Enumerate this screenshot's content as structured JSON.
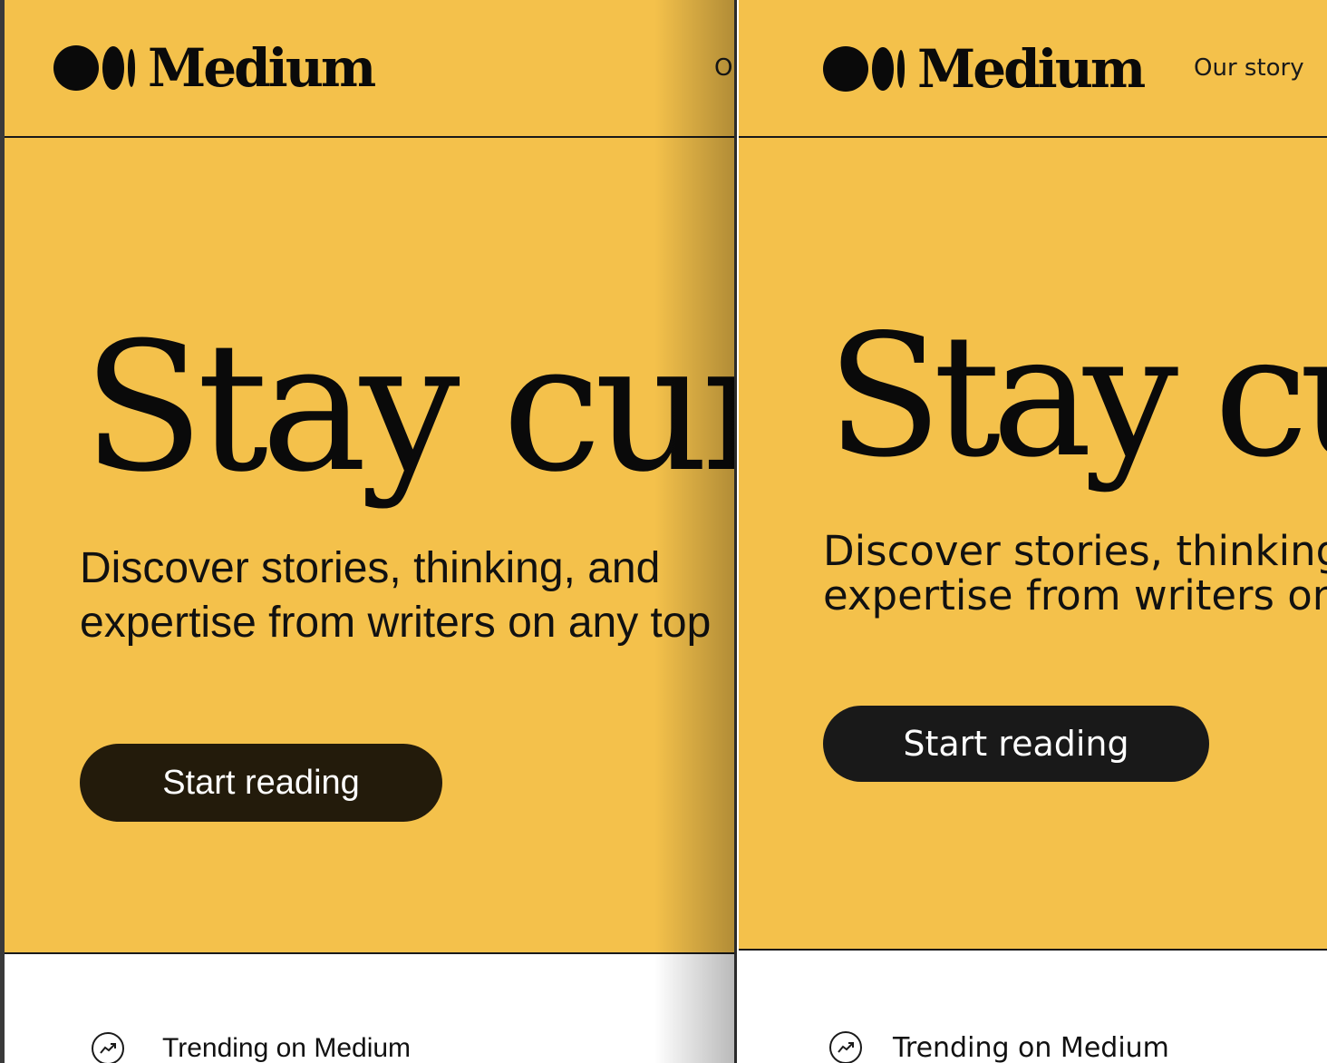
{
  "left": {
    "brand": "Medium",
    "nav_partial": "O",
    "headline": "Stay curio",
    "subtitle_line1": "Discover stories, thinking, and",
    "subtitle_line2": "expertise from writers on any top",
    "cta": "Start reading",
    "trending": "Trending on Medium"
  },
  "right": {
    "brand": "Medium",
    "nav": "Our story",
    "headline": "Stay curi",
    "subtitle_line1": "Discover stories, thinking,",
    "subtitle_line2": "expertise from writers on a",
    "cta": "Start reading",
    "trending": "Trending on Medium"
  },
  "colors": {
    "hero_bg": "#f4c14b",
    "text": "#0a0a0a",
    "cta_left": "#231b0b",
    "cta_right": "#191919"
  },
  "icons": [
    "medium-logo-icon",
    "trending-icon"
  ]
}
